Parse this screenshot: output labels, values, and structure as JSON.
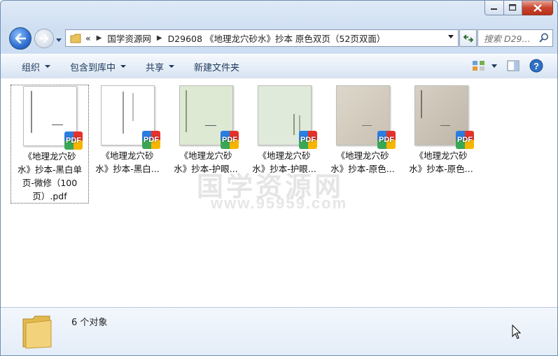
{
  "window": {
    "caption_buttons": [
      "minimize",
      "maximize",
      "close"
    ]
  },
  "address_bar": {
    "overflow": "«",
    "breadcrumbs": [
      "国学资源网",
      "D29608 《地理龙穴砂水》抄本 原色双页（52页双面）"
    ]
  },
  "search": {
    "placeholder": "搜索 D29..."
  },
  "toolbar": {
    "organize": "组织",
    "include_in_library": "包含到库中",
    "share": "共享",
    "new_folder": "新建文件夹"
  },
  "files": [
    {
      "label": "《地理龙穴砂\n水》抄本-黑白单\n页-微修（100\n页）.pdf",
      "thumb_bg": "#ffffff",
      "selected": true
    },
    {
      "label": "《地理龙穴砂\n水》抄本-黑白...",
      "thumb_bg": "#ffffff",
      "selected": false
    },
    {
      "label": "《地理龙穴砂\n水》抄本-护眼...",
      "thumb_bg": "#dde9d2",
      "selected": false
    },
    {
      "label": "《地理龙穴砂\n水》抄本-护眼...",
      "thumb_bg": "#dfeadb",
      "selected": false
    },
    {
      "label": "《地理龙穴砂\n水》抄本-原色...",
      "thumb_bg": "#d8d2c4",
      "selected": false
    },
    {
      "label": "《地理龙穴砂\n水》抄本-原色...",
      "thumb_bg": "#d3cbbf",
      "selected": false
    }
  ],
  "badge_text": "PDF",
  "watermark": {
    "line1": "国学资源网",
    "line2": "www.95959.com"
  },
  "details": {
    "count": "6 个对象"
  }
}
